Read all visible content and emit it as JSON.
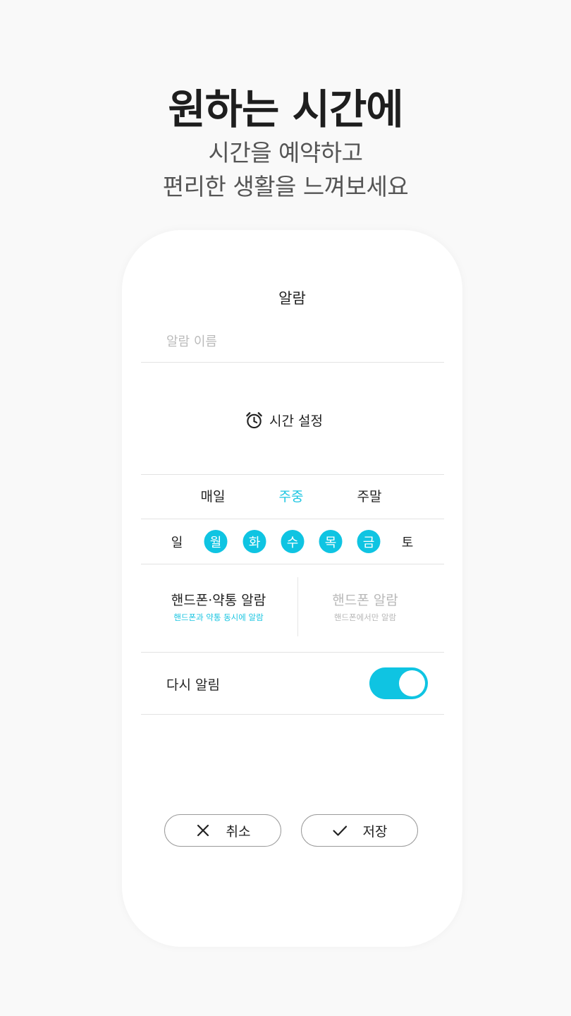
{
  "promo": {
    "headline": "원하는 시간에",
    "subline1": "시간을 예약하고",
    "subline2": "편리한 생활을 느껴보세요"
  },
  "alarm": {
    "title": "알람",
    "name_placeholder": "알람 이름",
    "name_value": "",
    "time_set_label": "시간 설정",
    "time_set_icon": "alarm-clock-icon",
    "frequency": {
      "options": [
        "매일",
        "주중",
        "주말"
      ],
      "selected": "주중"
    },
    "days": [
      {
        "label": "일",
        "selected": false
      },
      {
        "label": "월",
        "selected": true
      },
      {
        "label": "화",
        "selected": true
      },
      {
        "label": "수",
        "selected": true
      },
      {
        "label": "목",
        "selected": true
      },
      {
        "label": "금",
        "selected": true
      },
      {
        "label": "토",
        "selected": false
      }
    ],
    "modes": [
      {
        "title": "핸드폰·약통 알람",
        "desc": "핸드폰과 약통 동시에 알람",
        "selected": true
      },
      {
        "title": "핸드폰 알람",
        "desc": "핸드폰에서만 알람",
        "selected": false
      }
    ],
    "snooze": {
      "label": "다시 알림",
      "enabled": true
    },
    "buttons": {
      "cancel_label": "취소",
      "cancel_icon": "close-icon",
      "save_label": "저장",
      "save_icon": "check-icon"
    }
  },
  "colors": {
    "accent": "#0fc4e2",
    "background": "#f9f9f9",
    "card": "#ffffff",
    "muted": "#b8b8b8"
  }
}
